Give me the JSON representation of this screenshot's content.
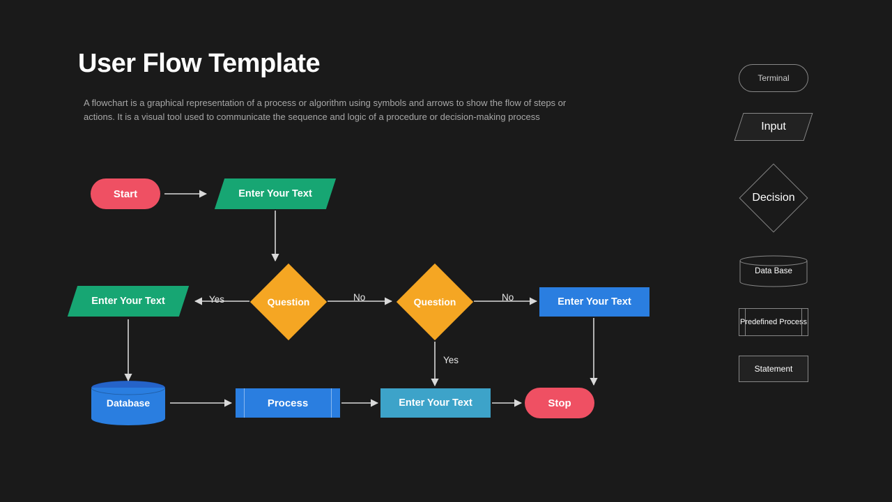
{
  "title": "User Flow Template",
  "description": "A flowchart is a graphical representation of a process or algorithm using symbols and arrows to show the flow of steps or actions. It is a visual tool used to communicate the sequence and logic of a procedure or decision-making process",
  "legend": {
    "terminal": "Terminal",
    "input": "Input",
    "decision": "Decision",
    "database": "Data Base",
    "predefined": "Predefined Process",
    "statement": "Statement"
  },
  "nodes": {
    "start": "Start",
    "input1": "Enter Your Text",
    "input2": "Enter Your Text",
    "q1": "Question",
    "q2": "Question",
    "rect_right": "Enter Your Text",
    "rect_cyan": "Enter Your Text",
    "process": "Process",
    "database": "Database",
    "stop": "Stop"
  },
  "edges": {
    "yes1": "Yes",
    "no1": "No",
    "no2": "No",
    "yes2": "Yes"
  },
  "colors": {
    "bg": "#1a1a1a",
    "red": "#ef5063",
    "green": "#17a673",
    "orange": "#f5a623",
    "blue": "#2a7ee0",
    "cyan": "#3da3c9"
  }
}
